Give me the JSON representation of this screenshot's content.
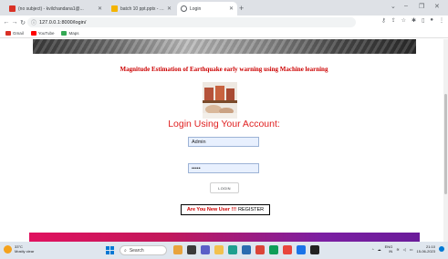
{
  "browser": {
    "tabs": [
      {
        "label": "(no subject) - kvilchandana1@...",
        "favicon_color": "#d93025",
        "active": false
      },
      {
        "label": "batch 10 ppt.pptx - Google Sli...",
        "favicon_color": "#f4b400",
        "active": false
      },
      {
        "label": "Login",
        "favicon_color": "#5f6368",
        "active": true
      }
    ],
    "new_tab": "+",
    "window_controls": {
      "minimize": "–",
      "restore": "❐",
      "close": "✕"
    },
    "url": "127.0.0.1:8000/login/",
    "bookmarks": [
      {
        "label": "Gmail",
        "icon": "gmail-icon",
        "color": "#d93025"
      },
      {
        "label": "YouTube",
        "icon": "youtube-icon",
        "color": "#ff0000"
      },
      {
        "label": "Maps",
        "icon": "maps-icon",
        "color": "#34a853"
      }
    ]
  },
  "page": {
    "headline": "Magnitude Estimation of Earthquake early warning using Machine learning",
    "login_title": "Login Using Your Account:",
    "username_value": "Admin",
    "password_value": "•••••",
    "login_button": "LOGIN",
    "register_prompt": "Are You New User !!!",
    "register_link": "REGISTER",
    "colors": {
      "headline": "#cc0000",
      "title": "#e02020",
      "footer_start": "#e0115f",
      "footer_end": "#6a1b9a"
    }
  },
  "taskbar": {
    "weather_temp": "33°C",
    "weather_desc": "Mostly clear",
    "search_placeholder": "Search",
    "tray_lang": "ENG",
    "tray_region": "IN",
    "time": "21:10",
    "date": "15-06-2023"
  }
}
